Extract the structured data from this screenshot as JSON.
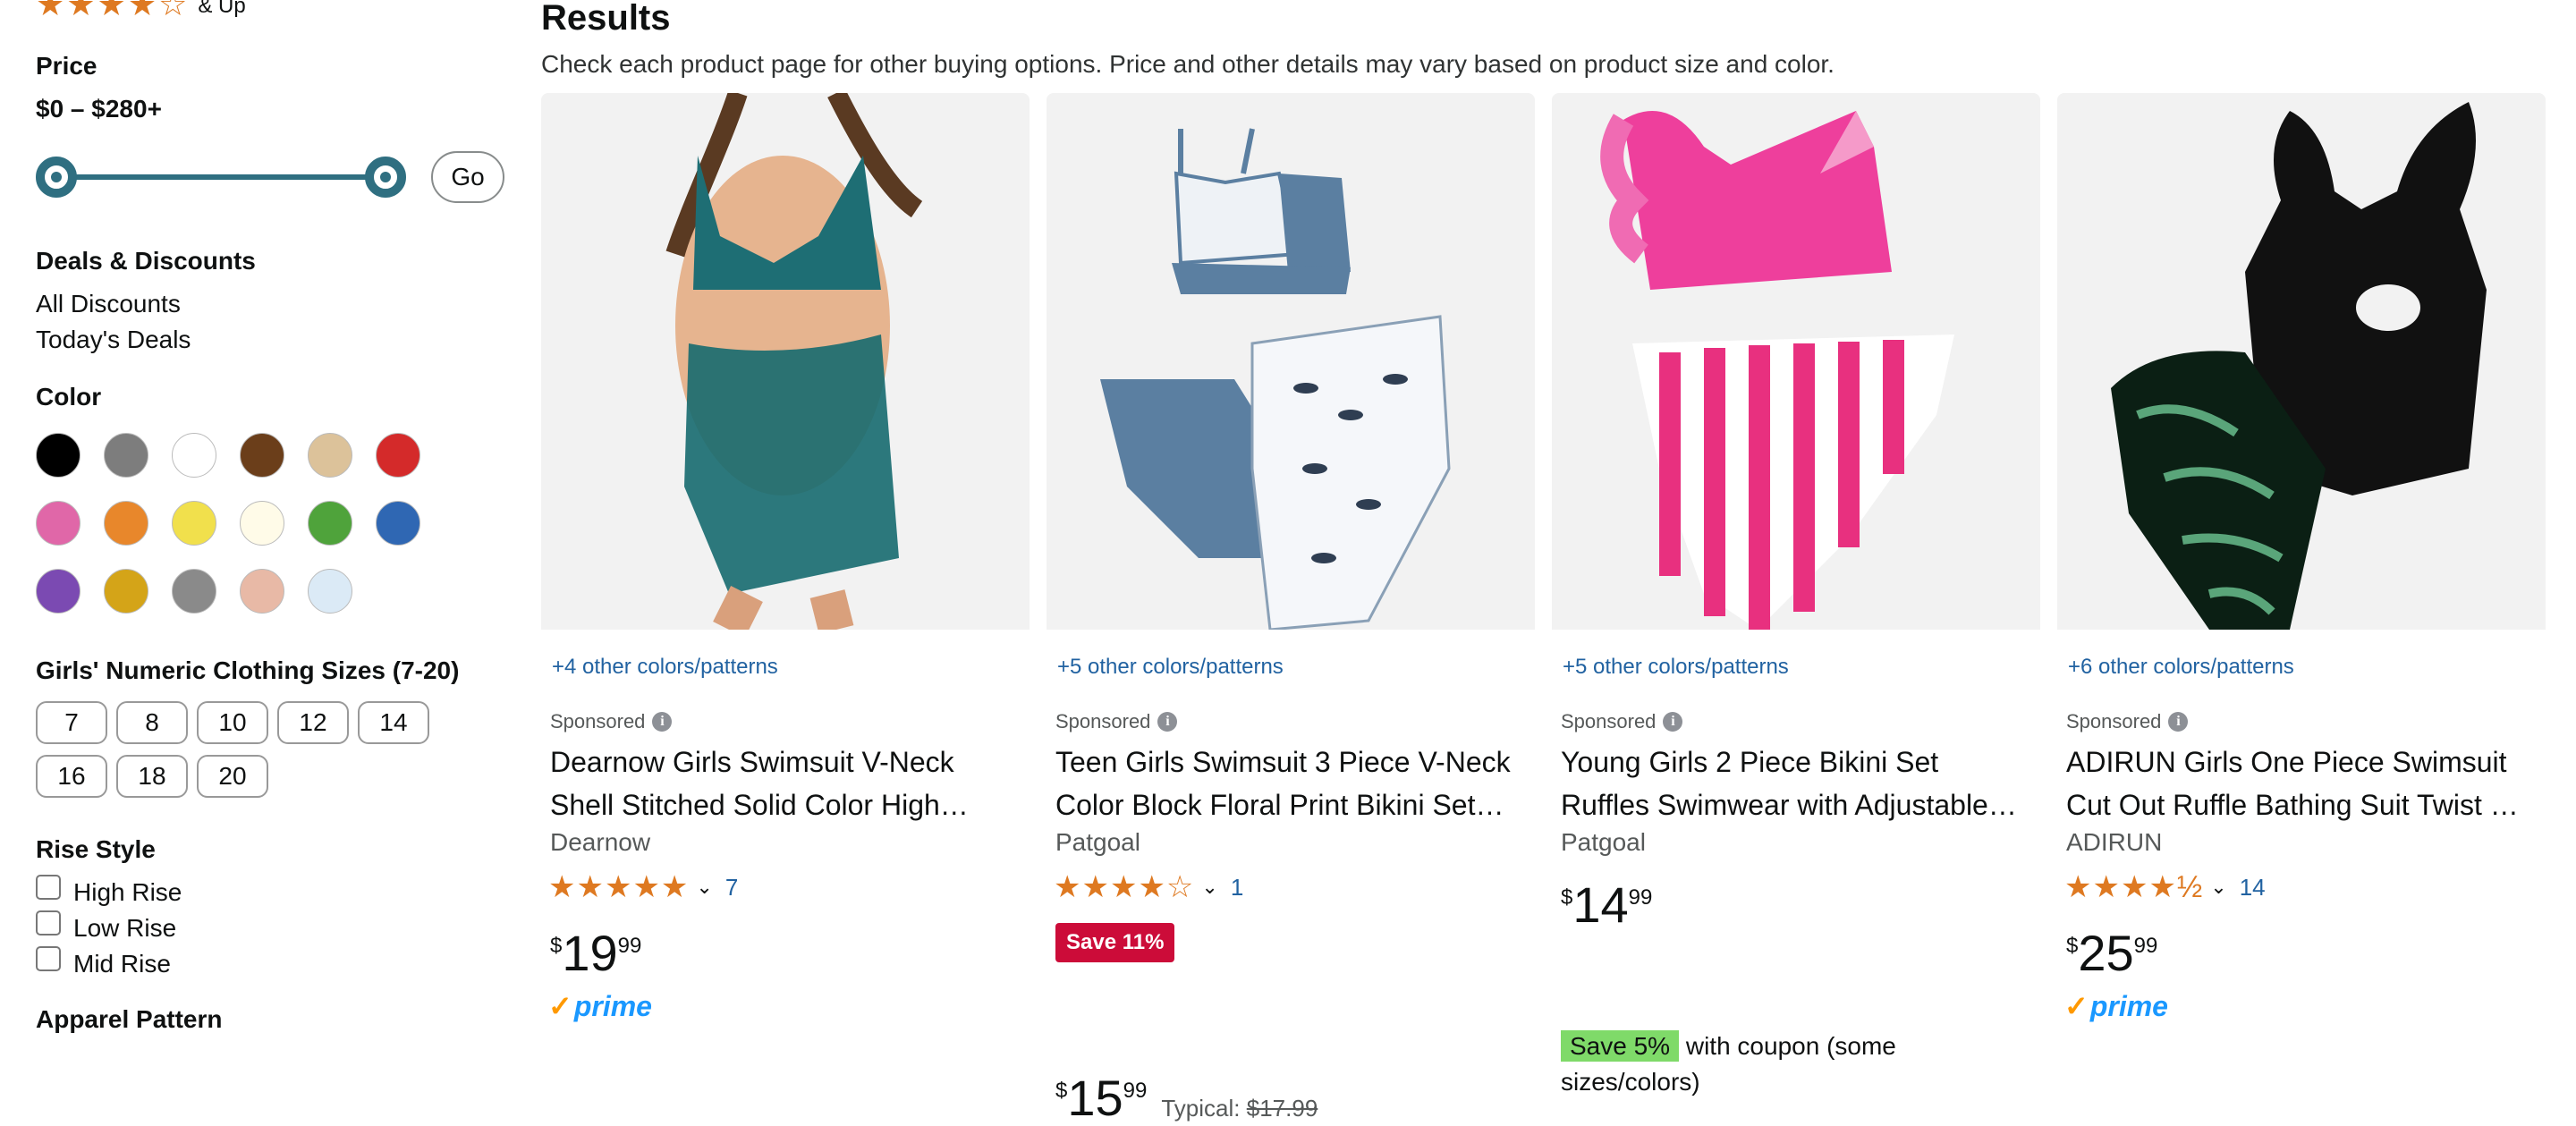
{
  "sidebar": {
    "rating_suffix": "& Up",
    "price": {
      "heading": "Price",
      "range": "$0 – $280+",
      "go_label": "Go"
    },
    "deals": {
      "heading": "Deals & Discounts",
      "items": [
        "All Discounts",
        "Today's Deals"
      ]
    },
    "color": {
      "heading": "Color",
      "swatches": [
        "#000000",
        "#7d7d7d",
        "#ffffff",
        "#6b3e1a",
        "#dcc29a",
        "#d42a2a",
        "#e067a8",
        "#e8872b",
        "#f1e04c",
        "#fffbe8",
        "#4fa33b",
        "#2f67b3",
        "#7b4ab2",
        "#d4a418",
        "#8a8a8a",
        "#e8b9a6",
        "#dbeaf6"
      ]
    },
    "sizes": {
      "heading": "Girls' Numeric Clothing Sizes (7-20)",
      "items": [
        "7",
        "8",
        "10",
        "12",
        "14",
        "16",
        "18",
        "20"
      ]
    },
    "rise": {
      "heading": "Rise Style",
      "items": [
        "High Rise",
        "Low Rise",
        "Mid Rise"
      ]
    },
    "apparel_heading": "Apparel Pattern"
  },
  "results": {
    "title": "Results",
    "subtitle": "Check each product page for other buying options. Price and other details may vary based on product size and color.",
    "products": [
      {
        "colors_link": "+4 other colors/patterns",
        "sponsored": "Sponsored",
        "title_line1": "Dearnow Girls Swimsuit V-Neck",
        "title_line2": "Shell Stitched Solid Color High…",
        "brand": "Dearnow",
        "stars": "★★★★★",
        "rating_count": "7",
        "price_symbol": "$",
        "price_whole": "19",
        "price_fraction": "99",
        "prime": "prime"
      },
      {
        "colors_link": "+5 other colors/patterns",
        "sponsored": "Sponsored",
        "title_line1": "Teen Girls Swimsuit 3 Piece V-Neck",
        "title_line2": "Color Block Floral Print Bikini Set…",
        "brand": "Patgoal",
        "stars": "★★★★☆",
        "rating_count": "1",
        "save_badge": "Save 11%",
        "price_symbol": "$",
        "price_whole": "15",
        "price_fraction": "99",
        "typical_label": "Typical:",
        "typical_price": "$17.99"
      },
      {
        "colors_link": "+5 other colors/patterns",
        "sponsored": "Sponsored",
        "title_line1": "Young Girls 2 Piece Bikini Set",
        "title_line2": "Ruffles Swimwear with Adjustable…",
        "brand": "Patgoal",
        "price_symbol": "$",
        "price_whole": "14",
        "price_fraction": "99",
        "coupon_badge": "Save 5%",
        "coupon_text": "with coupon (some sizes/colors)"
      },
      {
        "colors_link": "+6 other colors/patterns",
        "sponsored": "Sponsored",
        "title_line1": "ADIRUN Girls One Piece Swimsuit",
        "title_line2": "Cut Out Ruffle Bathing Suit Twist …",
        "brand": "ADIRUN",
        "stars": "★★★★½",
        "rating_count": "14",
        "price_symbol": "$",
        "price_whole": "25",
        "price_fraction": "99",
        "prime": "prime"
      }
    ]
  }
}
